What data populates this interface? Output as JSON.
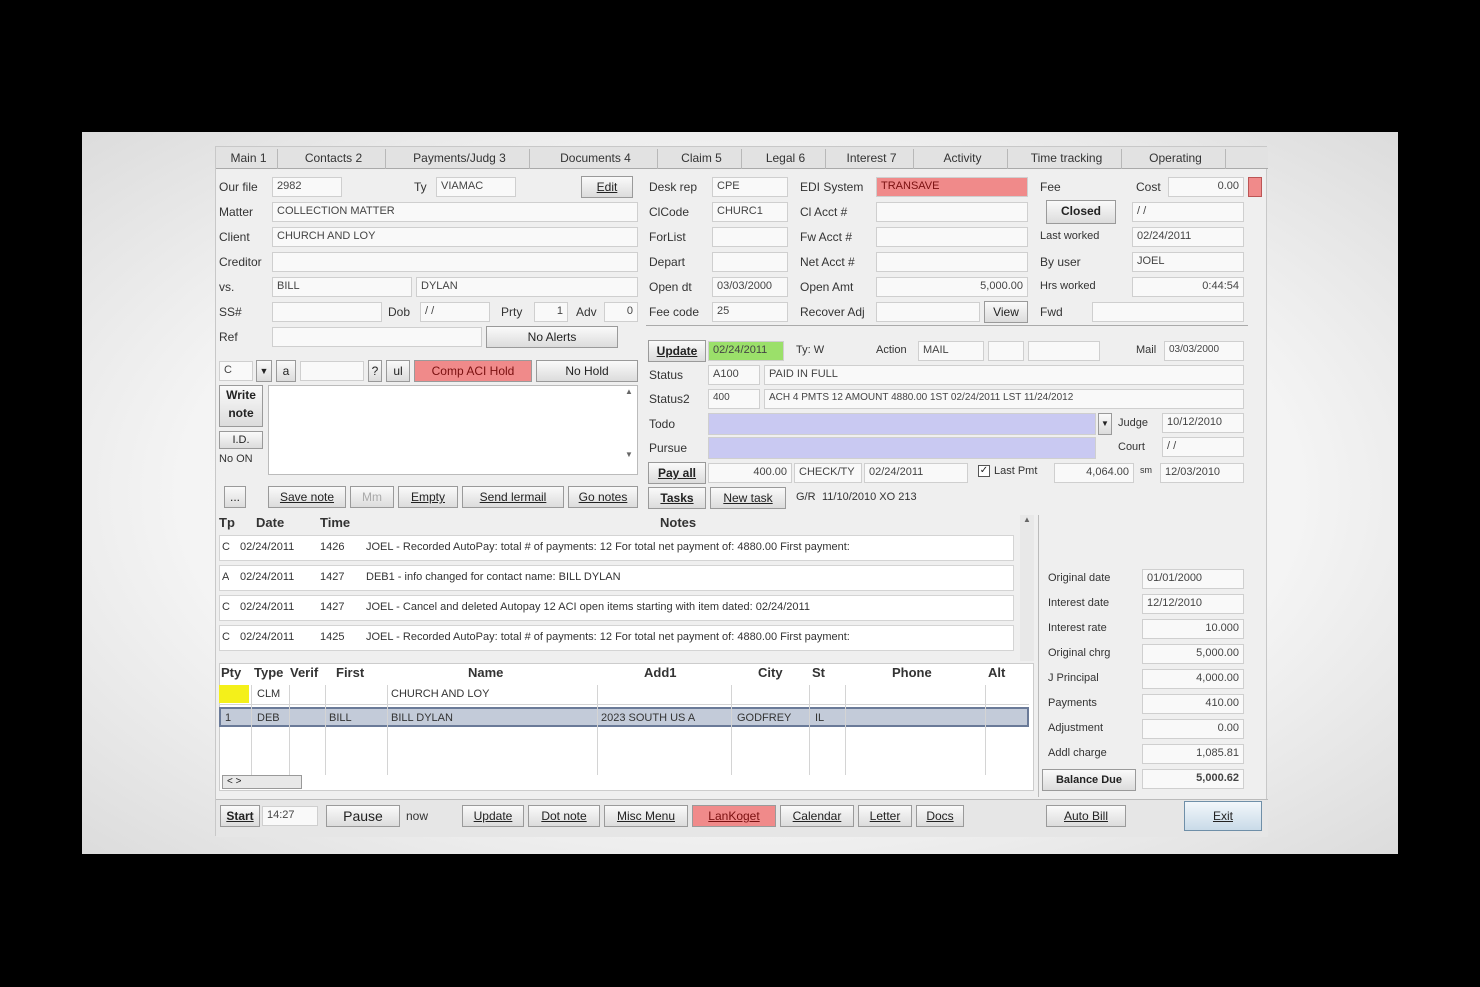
{
  "tabs": [
    "Main 1",
    "Contacts 2",
    "Payments/Judg 3",
    "Documents 4",
    "Claim 5",
    "Legal 6",
    "Interest 7",
    "Activity",
    "Time tracking",
    "Operating"
  ],
  "header": {
    "our_no_label": "Our file",
    "our_no": "2982",
    "type_label": "Ty",
    "type": "VIAMAC",
    "edit_label": "Edit",
    "matter_label": "Matter",
    "matter": "COLLECTION MATTER",
    "client_label": "Client",
    "client": "CHURCH AND LOY",
    "creditor_label": "Creditor",
    "creditor": "",
    "vs_label": "vs.",
    "vs_first": "BILL",
    "vs_last": "DYLAN",
    "ssn_label": "SS#",
    "dob_label": "Dob",
    "dob": "/ /",
    "prty_label": "Prty",
    "prty": "1",
    "adv_label": "Adv",
    "adv": "0",
    "ref_label": "Ref",
    "no_alerts_label": "No Alerts"
  },
  "desk": {
    "desk_rep_label": "Desk rep",
    "desk_rep": "CPE",
    "clcode_label": "ClCode",
    "clcode": "CHURC1",
    "forlist_label": "ForList",
    "forlist": "",
    "depart_label": "Depart",
    "depart": "",
    "open_dt_label": "Open dt",
    "open_dt": "03/03/2000",
    "fee_code_label": "Fee code",
    "fee_code": "25"
  },
  "edi": {
    "edi_label": "EDI System",
    "edi": "TRANSAVE",
    "clacct_label": "Cl Acct #",
    "clacct": "",
    "fwacct_label": "Fw Acct #",
    "fwacct": "",
    "netacct_label": "Net Acct #",
    "netacct": "",
    "open_amt_label": "Open Amt",
    "open_amt": "5,000.00",
    "recover_label": "Recover Adj",
    "view_label": "View"
  },
  "right_top": {
    "fee_label": "Fee",
    "cost_label": "Cost",
    "cost": "0.00",
    "closed_label": "Closed",
    "closed_date": "/ /",
    "last_worked_label": "Last worked",
    "last_worked": "02/24/2011",
    "by_user_label": "By user",
    "by_user": "JOEL",
    "hrs_worked_label": "Hrs worked",
    "hrs_worked": "0:44:54",
    "fwd_label": "Fwd"
  },
  "note_toolbar": {
    "code": "C",
    "comp_aci_label": "Comp ACI Hold",
    "no_hold_label": "No Hold"
  },
  "note_side": {
    "write_label": "Write",
    "note_label": "note",
    "ld": "I.D.",
    "no_on": "No ON"
  },
  "note_buttons": {
    "small": "...",
    "save_note": "Save note",
    "grey": "Mm",
    "empty": "Empty",
    "send_lermail": "Send lermail",
    "go_notes": "Go notes"
  },
  "status": {
    "update_label": "Update",
    "update_date": "02/24/2011",
    "ty_label": "Ty: W",
    "action_label": "Action",
    "action": "MAIL",
    "mail_label": "Mail",
    "mail": "03/03/2000",
    "status_label": "Status",
    "status_code": "A100",
    "status_text": "PAID IN FULL",
    "status2_label": "Status2",
    "status2_code": "400",
    "status2_text": "ACH 4 PMTS  12 AMOUNT 4880.00  1ST 02/24/2011 LST 11/24/2012",
    "todo_label": "Todo",
    "pursue_label": "Pursue",
    "judge_label": "Judge",
    "judge": "10/12/2010",
    "court_label": "Court",
    "court": "/ /",
    "pay_all_label": "Pay all",
    "pay_amt": "400.00",
    "pay_method": "CHECK/TY",
    "pay_date": "02/24/2011",
    "last_pmt_label": "Last Pmt",
    "last_pmt": "4,064.00",
    "sm_label": "sm",
    "last_pmt_date": "12/03/2010",
    "tasks_label": "Tasks",
    "new_task_label": "New task",
    "gr_label": "G/R",
    "gr_value": "11/10/2010  XO 213"
  },
  "notes": {
    "headers": [
      "Tp",
      "Date",
      "Time",
      "Notes"
    ],
    "rows": [
      {
        "tp": "C",
        "date": "02/24/2011",
        "time": "1426",
        "text": "JOEL - Recorded AutoPay: total # of payments: 12 For total net payment of: 4880.00  First payment:"
      },
      {
        "tp": "A",
        "date": "02/24/2011",
        "time": "1427",
        "text": "DEB1 - info changed for contact name: BILL DYLAN"
      },
      {
        "tp": "C",
        "date": "02/24/2011",
        "time": "1427",
        "text": "JOEL - Cancel and deleted Autopay 12 ACI      open items starting with item dated: 02/24/2011"
      },
      {
        "tp": "C",
        "date": "02/24/2011",
        "time": "1425",
        "text": "JOEL - Recorded AutoPay: total # of payments: 12 For total net payment of: 4880.00  First payment:"
      }
    ]
  },
  "contacts": {
    "headers": [
      "Pty",
      "Type",
      "Verif",
      "First",
      "Name",
      "Add1",
      "City",
      "St",
      "Phone",
      "Alt"
    ],
    "rows": [
      {
        "pty": "",
        "type": "CLM",
        "first": "",
        "name": "CHURCH AND LOY",
        "add1": "",
        "city": "",
        "st": ""
      },
      {
        "pty": "1",
        "type": "DEB",
        "first": "BILL",
        "name": "BILL DYLAN",
        "add1": "2023 SOUTH US A",
        "city": "GODFREY",
        "st": "IL"
      }
    ]
  },
  "balance": {
    "original_date_label": "Original date",
    "original_date": "01/01/2000",
    "interest_date_label": "Interest date",
    "interest_date": "12/12/2010",
    "interest_rate_label": "Interest rate",
    "interest_rate": "10.000",
    "original_chrg_label": "Original chrg",
    "original_chrg": "5,000.00",
    "principal_label": "J Principal",
    "principal": "4,000.00",
    "payments_label": "Payments",
    "payments": "410.00",
    "adjustment_label": "Adjustment",
    "adjustment": "0.00",
    "addl_charge_label": "Addl charge",
    "addl_charge": "1,085.81",
    "balance_due_label": "Balance Due",
    "balance_due": "5,000.62"
  },
  "bottom": {
    "start_label": "Start",
    "start_time": "14:27",
    "pause_label": "Pause",
    "now_label": "now",
    "update": "Update",
    "dot_note": "Dot note",
    "misc_menu": "Misc Menu",
    "lankoget": "LanKoget",
    "calendar": "Calendar",
    "letter": "Letter",
    "docs": "Docs",
    "auto_bill": "Auto Bill",
    "exit": "Exit"
  },
  "hscroll_label": "< >"
}
